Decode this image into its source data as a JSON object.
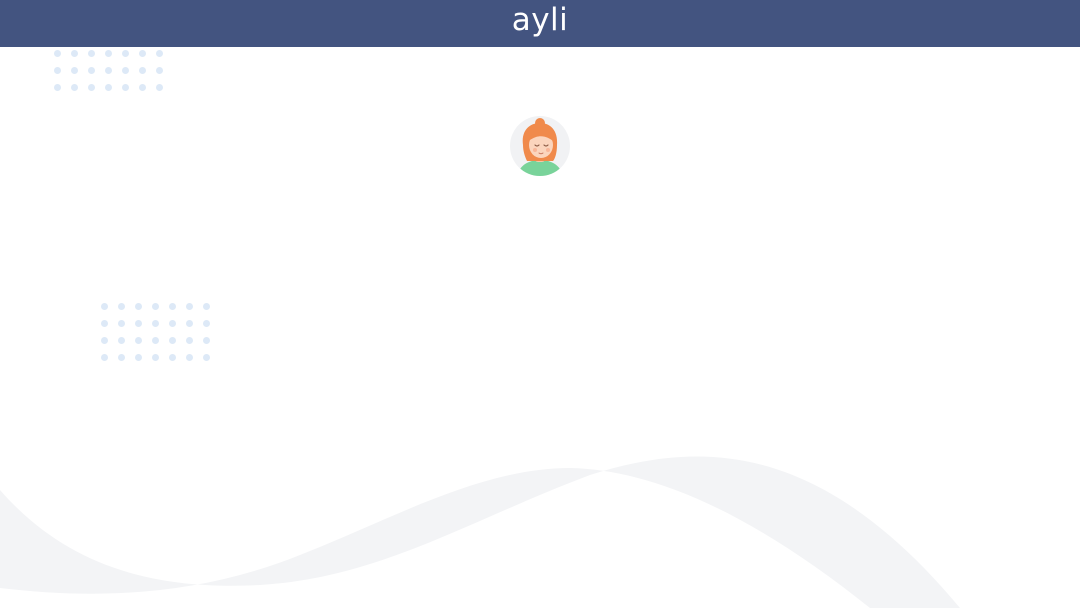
{
  "header": {
    "brand": "ayli",
    "background_color": "#435480",
    "text_color": "#ffffff"
  },
  "avatar": {
    "icon": "user-avatar-icon"
  },
  "decor": {
    "dot_color": "#dde9f7",
    "wave_color": "#f3f4f6"
  }
}
